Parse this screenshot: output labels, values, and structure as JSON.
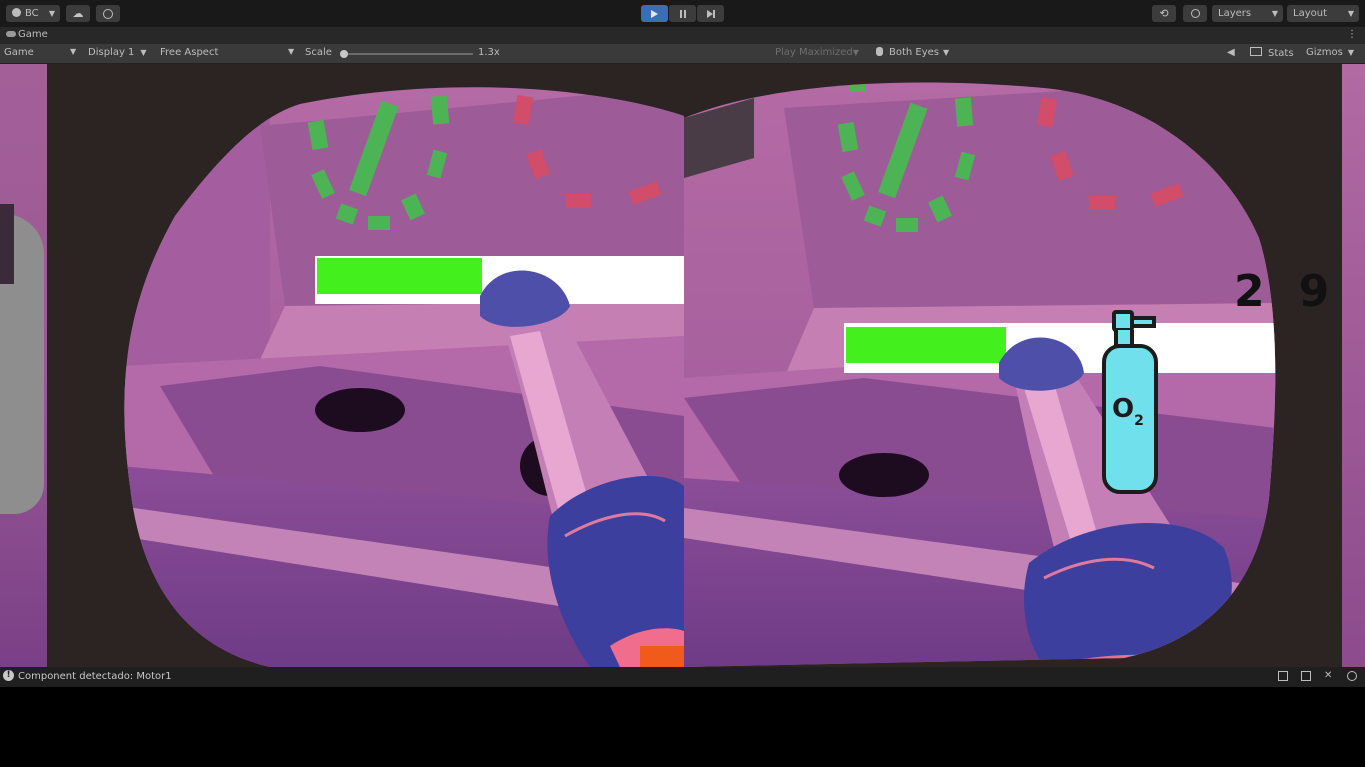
{
  "toolbar": {
    "account_label": "BC",
    "layers_label": "Layers",
    "layout_label": "Layout"
  },
  "tab": {
    "title": "Game"
  },
  "game_toolbar": {
    "view_select": "Game",
    "display": "Display 1",
    "aspect": "Free Aspect",
    "scale_label": "Scale",
    "scale_value": "1.3x",
    "play_maximized": "Play Maximized",
    "eyes": "Both Eyes",
    "stats": "Stats",
    "gizmos": "Gizmos"
  },
  "hud": {
    "o2_label": "O",
    "o2_subscript": "2",
    "gauge_fill": 0.45,
    "right_counter": "29"
  },
  "status": {
    "message": "Component detectado: Motor1"
  },
  "colors": {
    "play_active": "#3a6fb8",
    "hud_green": "#43ef1c",
    "dial_green": "#4db456",
    "dial_red": "#d14d6a",
    "o2_tank": "#6fe0ec",
    "wall_pink": "#b96aa4"
  }
}
